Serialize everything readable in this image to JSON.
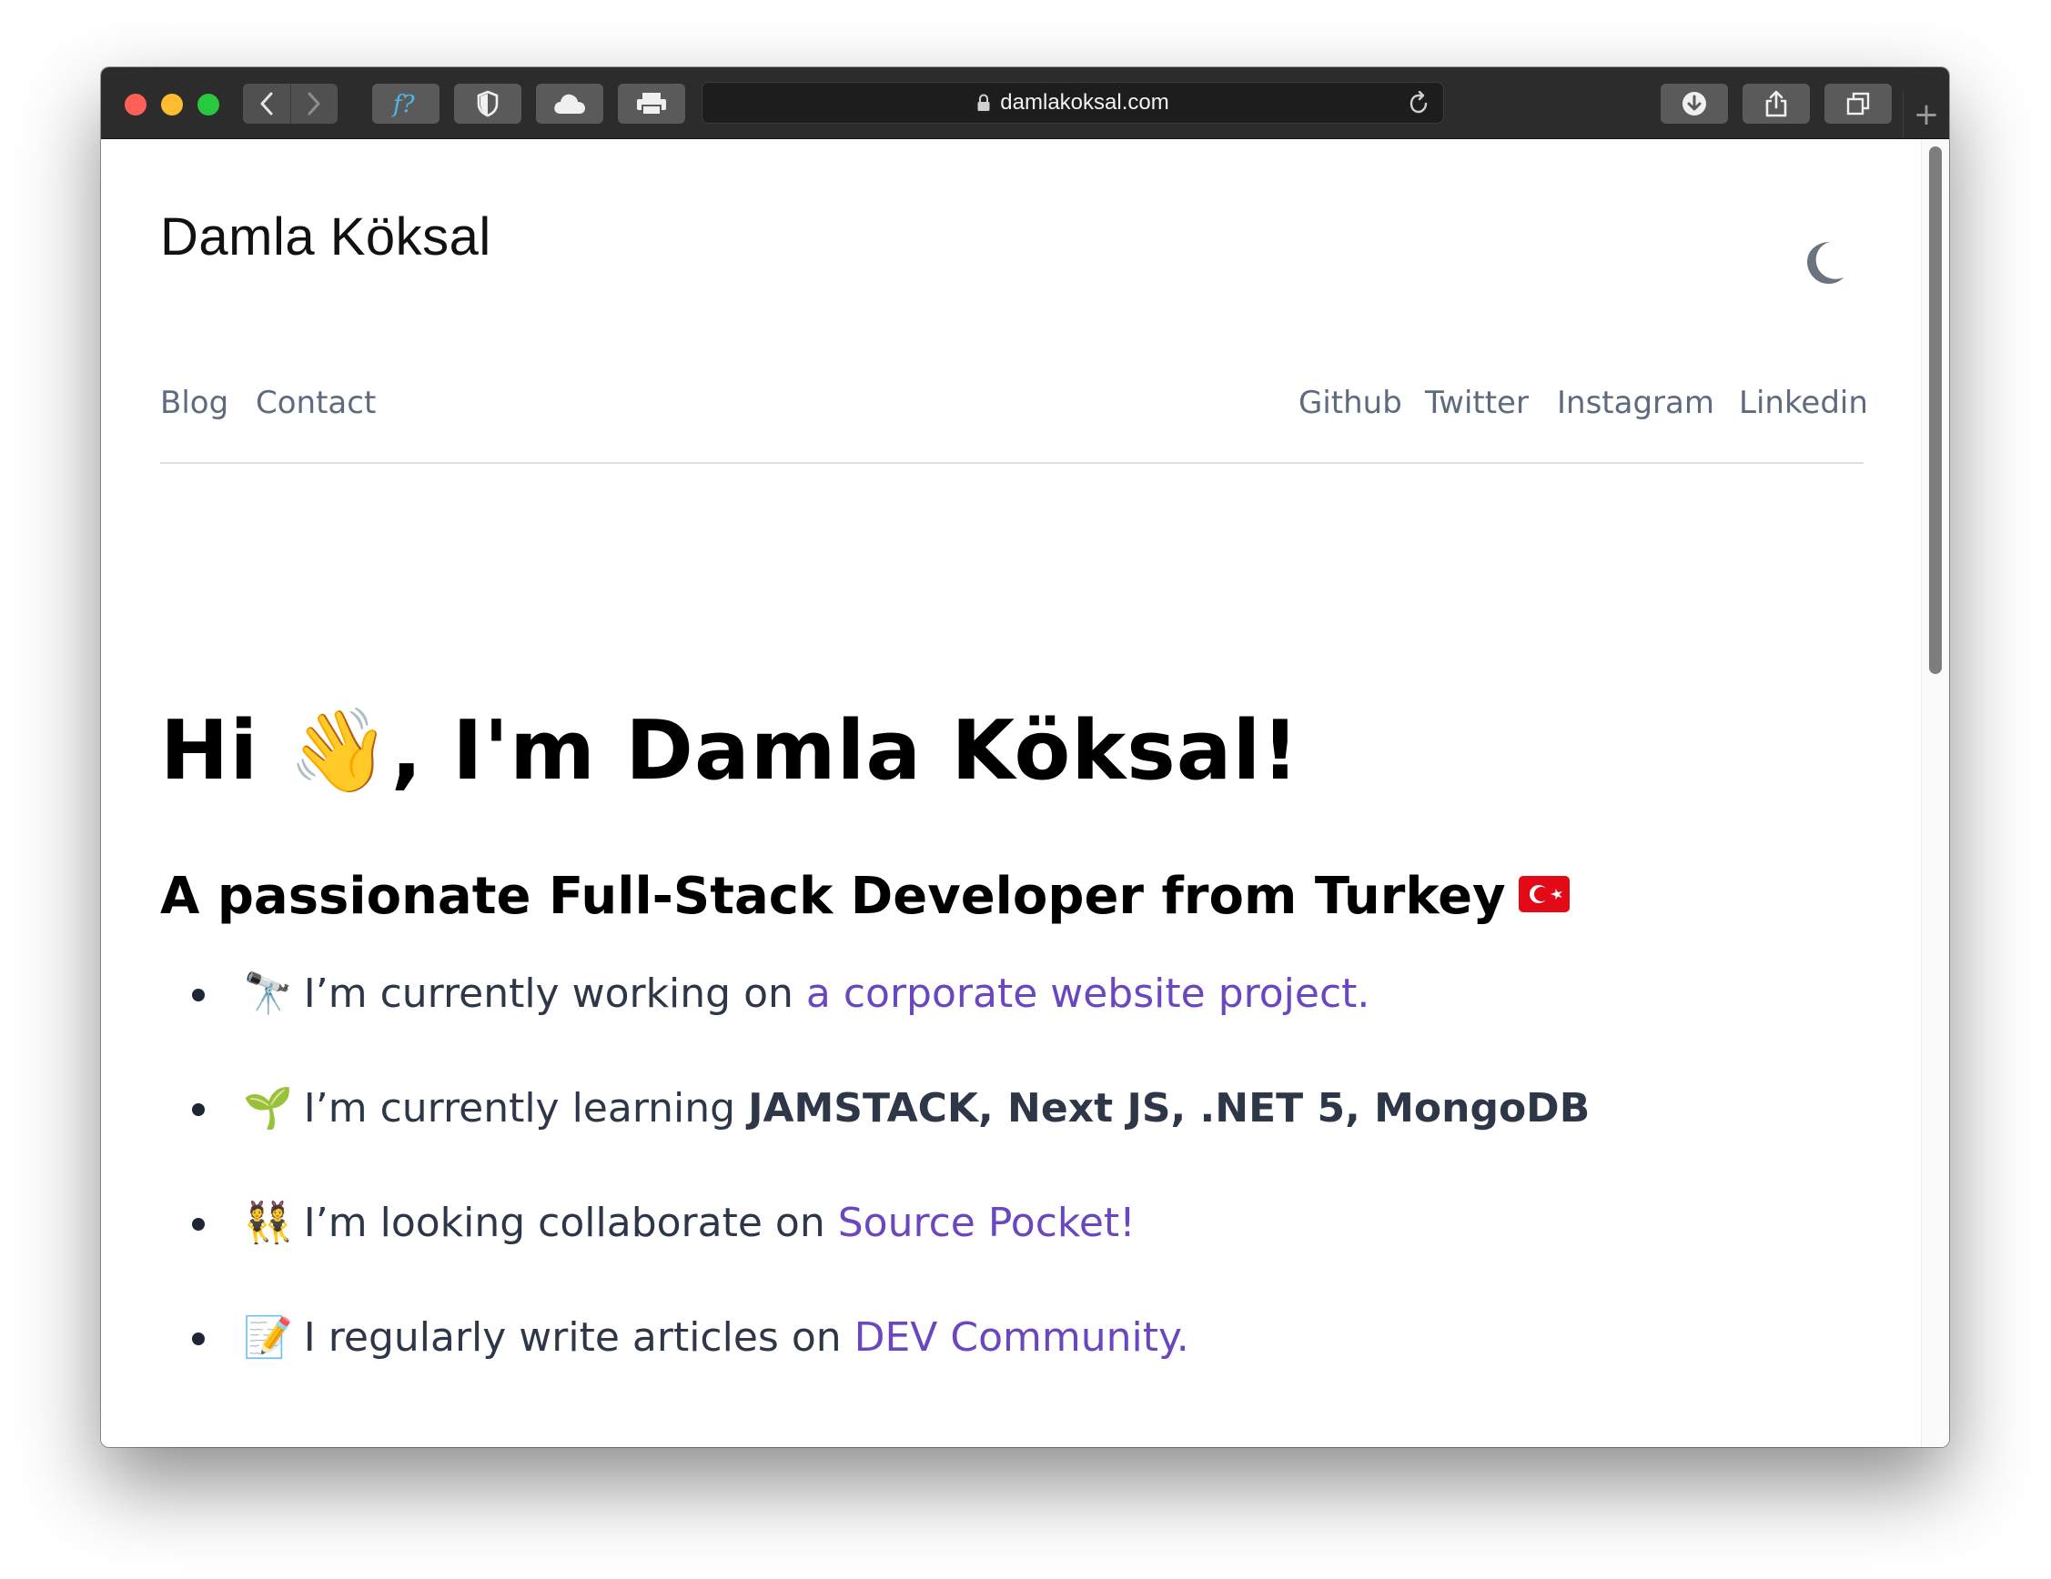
{
  "browser": {
    "url": "damlakoksal.com",
    "toolbar_icons": [
      "back-icon",
      "forward-icon",
      "fonts-ext-icon",
      "shield-icon",
      "cloud-icon",
      "print-icon",
      "download-icon",
      "share-icon",
      "tabs-icon"
    ],
    "new_tab_glyph": "+"
  },
  "site": {
    "title": "Damla Köksal",
    "nav_left": [
      "Blog",
      "Contact"
    ],
    "nav_right": [
      "Github",
      "Twitter",
      "Instagram",
      "Linkedin"
    ],
    "theme_toggle_icon": "moon-icon"
  },
  "hero": {
    "greeting_pre": "Hi ",
    "greeting_emoji": "👋",
    "greeting_post": ", I'm Damla Köksal!"
  },
  "subtitle": {
    "text": "A passionate Full-Stack Developer from Turkey",
    "flag_icon": "turkey-flag-icon"
  },
  "items": [
    {
      "emoji": "🔭",
      "text": "I’m currently working on ",
      "link": "a corporate website project."
    },
    {
      "emoji": "🌱",
      "text": "I’m currently learning ",
      "bold": "JAMSTACK, Next JS, .NET 5, MongoDB"
    },
    {
      "emoji": "👯",
      "text": "I’m looking collaborate on ",
      "link": "Source Pocket!"
    },
    {
      "emoji": "📝",
      "text": "I regularly write articles on ",
      "link": "DEV Community."
    }
  ],
  "colors": {
    "link": "#6b46c1",
    "nav": "#5e6a7e",
    "body_text": "#2d3748",
    "heading": "#000000"
  }
}
